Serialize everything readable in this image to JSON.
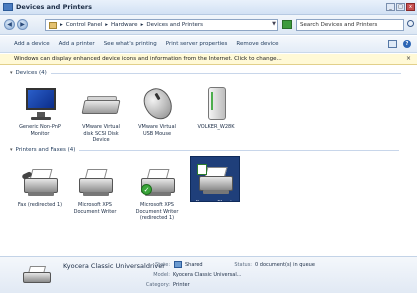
{
  "window": {
    "title": "Devices and Printers"
  },
  "address": {
    "crumbs": [
      "Control Panel",
      "Hardware",
      "Devices and Printers"
    ],
    "search_placeholder": "Search Devices and Printers"
  },
  "commands": [
    "Add a device",
    "Add a printer",
    "See what's printing",
    "Print server properties",
    "Remove device"
  ],
  "infobar": {
    "text": "Windows can display enhanced device icons and information from the Internet. Click to change..."
  },
  "groups": {
    "devices": {
      "header": "Devices (4)",
      "items": [
        {
          "label": "Generic Non-PnP Monitor",
          "icon": "monitor-icon"
        },
        {
          "label": "VMware Virtual disk SCSI Disk Device",
          "icon": "disk-drive-icon"
        },
        {
          "label": "VMware Virtual USB Mouse",
          "icon": "mouse-icon"
        },
        {
          "label": "VOLKER_W28K",
          "icon": "computer-tower-icon"
        }
      ]
    },
    "printers": {
      "header": "Printers and Faxes (4)",
      "items": [
        {
          "label": "Fax (redirected 1)",
          "icon": "fax-icon"
        },
        {
          "label": "Microsoft XPS Document Writer",
          "icon": "printer-icon"
        },
        {
          "label": "Microsoft XPS Document Writer (redirected 1)",
          "icon": "default-printer-icon"
        },
        {
          "label": "Kyocera Classic Universaldriver",
          "icon": "printer-icon",
          "selected": true
        }
      ]
    }
  },
  "details": {
    "name": "Kyocera Classic Universaldriver",
    "state_label": "State:",
    "state_value": "Shared",
    "status_label": "Status:",
    "status_value": "0 document(s) in queue",
    "model_label": "Model:",
    "model_value": "Kyocera Classic Universal...",
    "category_label": "Category:",
    "category_value": "Printer"
  }
}
